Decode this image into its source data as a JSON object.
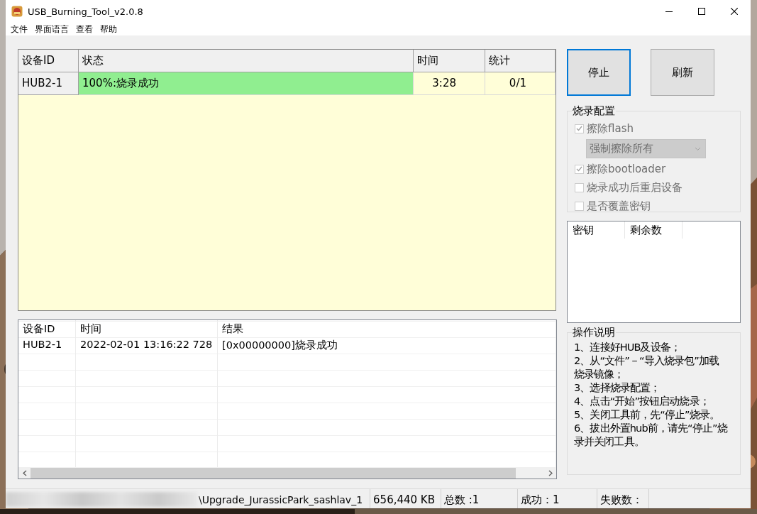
{
  "window": {
    "title": "USB_Burning_Tool_v2.0.8"
  },
  "menu": [
    "文件",
    "界面语言",
    "查看",
    "帮助"
  ],
  "device_table": {
    "columns": [
      "设备ID",
      "状态",
      "时间",
      "统计"
    ],
    "rows": [
      {
        "device_id": "HUB2-1",
        "status": "100%:烧录成功",
        "level": 1,
        "time": "3:28",
        "count": "0/1"
      }
    ]
  },
  "buttons": [
    {
      "label": "停止",
      "focused": true
    },
    {
      "label": "刷新",
      "focused": false
    }
  ],
  "burn_config": {
    "title": "烧录配置",
    "disabled": true,
    "options": [
      {
        "kind": "checkbox",
        "label": "擦除flash",
        "checked": true
      },
      {
        "kind": "dropdown",
        "value": "强制擦除所有"
      },
      {
        "kind": "checkbox",
        "label": "擦除bootloader",
        "checked": true
      },
      {
        "kind": "checkbox",
        "label": "烧录成功后重启设备",
        "checked": false
      },
      {
        "kind": "checkbox",
        "label": "是否覆盖密钥",
        "checked": false
      }
    ]
  },
  "key_list": {
    "columns": [
      "密钥",
      "剩余数"
    ]
  },
  "instructions": {
    "title": "操作说明",
    "items": [
      "1、连接好HUB及设备；",
      "2、从“文件”－“导入烧录包”加载烧录镜像；",
      "3、选择烧录配置；",
      "4、点击“开始”按钮启动烧录；",
      "5、关闭工具前，先“停止”烧录。",
      "6、拔出外置hub前，请先“停止”烧录并关闭工具。"
    ]
  },
  "log": {
    "columns": [
      "设备ID",
      "时间",
      "结果"
    ],
    "rows": [
      {
        "device_id": "HUB2-1",
        "time": "2022-02-01 13:16:22 728",
        "result": "[0x00000000]烧录成功"
      }
    ]
  },
  "status_bar": {
    "path": "\\Upgrade_JurassicPark_sashlav_1",
    "size": "656,440 KB",
    "total": "总数 :1",
    "success": "成功：1",
    "failed": "失败数："
  }
}
